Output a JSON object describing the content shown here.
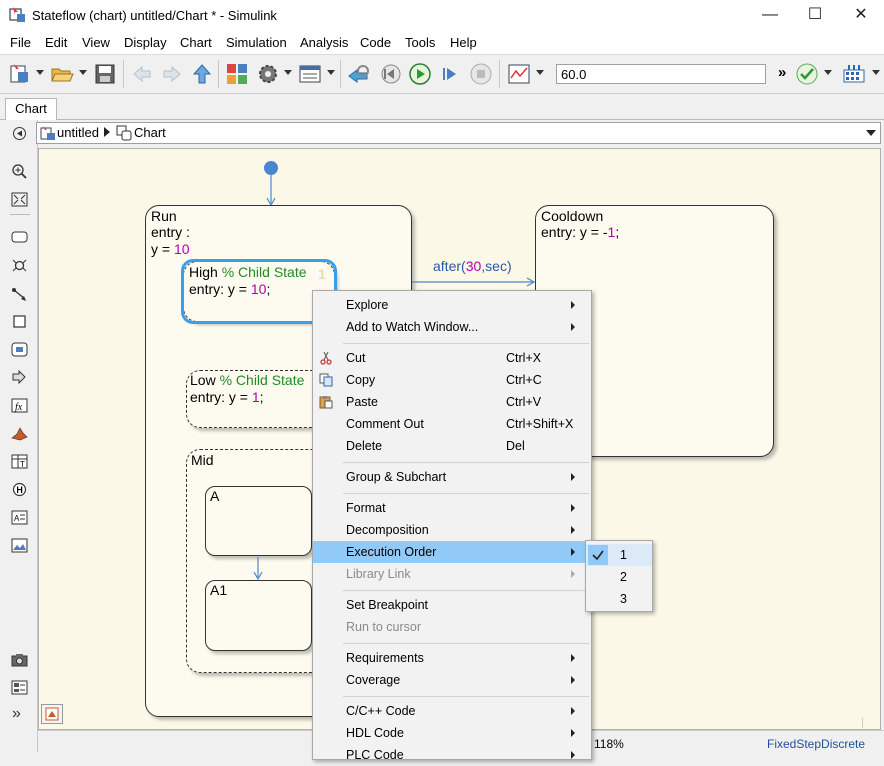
{
  "window": {
    "title": "Stateflow (chart) untitled/Chart * - Simulink",
    "minimize": "—",
    "maximize": "☐",
    "close": "✕"
  },
  "menu": [
    "File",
    "Edit",
    "View",
    "Display",
    "Chart",
    "Simulation",
    "Analysis",
    "Code",
    "Tools",
    "Help"
  ],
  "toolbar": {
    "stop_time": "60.0",
    "overflow": "»"
  },
  "tabs": {
    "chart": "Chart"
  },
  "breadcrumb": {
    "model": "untitled",
    "chart": "Chart"
  },
  "chart": {
    "run": {
      "name": "Run",
      "entry": "entry :",
      "assign": "y = ",
      "value": "10"
    },
    "high": {
      "name": "High ",
      "comment": "% Child State",
      "entry": "entry: y = ",
      "value": "10",
      "end": ";",
      "order": "1"
    },
    "low": {
      "name": "Low ",
      "comment": "% Child State",
      "entry": "entry: y = ",
      "value": "1",
      "end": ";"
    },
    "mid": {
      "name": "Mid"
    },
    "a": {
      "name": "A"
    },
    "a1": {
      "name": "A1"
    },
    "cooldown": {
      "name": "Cooldown",
      "entry": "entry: y = -",
      "value": "1",
      "end": ";"
    },
    "transition": {
      "pre": "after(",
      "num": "30",
      "post": ",sec)"
    }
  },
  "context_menu": {
    "explore": "Explore",
    "watch": "Add to Watch Window...",
    "cut": "Cut",
    "cut_sc": "Ctrl+X",
    "copy": "Copy",
    "copy_sc": "Ctrl+C",
    "paste": "Paste",
    "paste_sc": "Ctrl+V",
    "comment": "Comment Out",
    "comment_sc": "Ctrl+Shift+X",
    "delete": "Delete",
    "delete_sc": "Del",
    "group": "Group & Subchart",
    "format": "Format",
    "decomposition": "Decomposition",
    "exec_order": "Execution Order",
    "library_link": "Library Link",
    "set_bp": "Set Breakpoint",
    "run_cursor": "Run to cursor",
    "requirements": "Requirements",
    "coverage": "Coverage",
    "cpp_code": "C/C++ Code",
    "hdl_code": "HDL Code",
    "plc_code": "PLC Code"
  },
  "submenu": {
    "checked": "1",
    "items": [
      "1",
      "2",
      "3"
    ]
  },
  "status": {
    "zoom": "118%",
    "solver": "FixedStepDiscrete"
  },
  "colors": {
    "highlight": "#91c9f7",
    "selected_state": "#3a9ee8",
    "number": "#b000b0",
    "comment": "#228b22",
    "transition": "#2b5aa0"
  }
}
